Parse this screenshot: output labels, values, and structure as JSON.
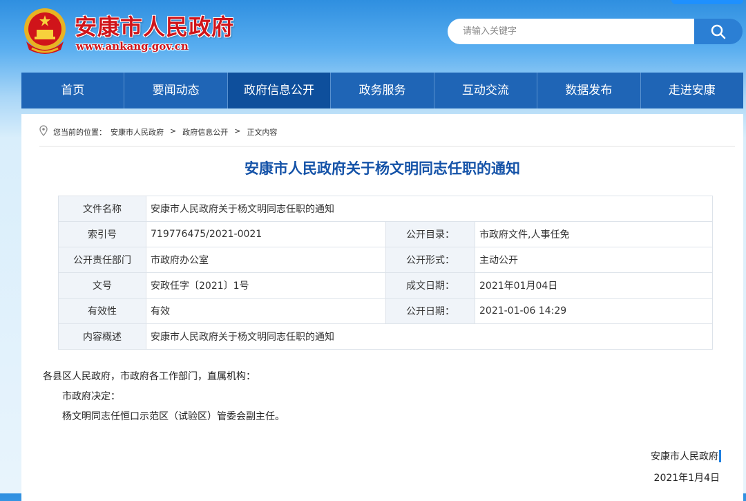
{
  "header": {
    "site_name": "安康市人民政府",
    "site_url": "www.ankang.gov.cn",
    "emblem_icon": "national-emblem-icon"
  },
  "search": {
    "placeholder": "请输入关键字",
    "button_icon": "search-icon"
  },
  "nav": {
    "items": [
      "首页",
      "要闻动态",
      "政府信息公开",
      "政务服务",
      "互动交流",
      "数据发布",
      "走进安康"
    ],
    "active": "政府信息公开"
  },
  "breadcrumb": {
    "prefix": "您当前的位置：",
    "items": [
      "安康市人民政府",
      "政府信息公开",
      "正文内容"
    ],
    "separator": ">"
  },
  "article": {
    "title": "安康市人民政府关于杨文明同志任职的通知",
    "meta": {
      "file_name_label": "文件名称",
      "file_name": "安康市人民政府关于杨文明同志任职的通知",
      "index_label": "索引号",
      "index": "719776475/2021-0021",
      "catalog_label": "公开目录：",
      "catalog": "市政府文件,人事任免",
      "dept_label": "公开责任部门",
      "dept": "市政府办公室",
      "form_label": "公开形式：",
      "form": "主动公开",
      "doc_no_label": "文号",
      "doc_no": "安政任字〔2021〕1号",
      "created_label": "成文日期：",
      "created": "2021年01月04日",
      "validity_label": "有效性",
      "validity": "有效",
      "published_label": "公开日期：",
      "published": "2021-01-06 14:29",
      "summary_label": "内容概述",
      "summary": "安康市人民政府关于杨文明同志任职的通知"
    },
    "body": {
      "salutation": "各县区人民政府，市政府各工作部门，直属机构：",
      "line1": "市政府决定：",
      "line2": "杨文明同志任恒口示范区（试验区）管委会副主任。"
    },
    "signature": "安康市人民政府",
    "date": "2021年1月4日"
  },
  "colors": {
    "nav_bg": "#1f65b6",
    "nav_active": "#0e4f9c",
    "title": "#1553a8",
    "brand_red": "#d0141a"
  }
}
